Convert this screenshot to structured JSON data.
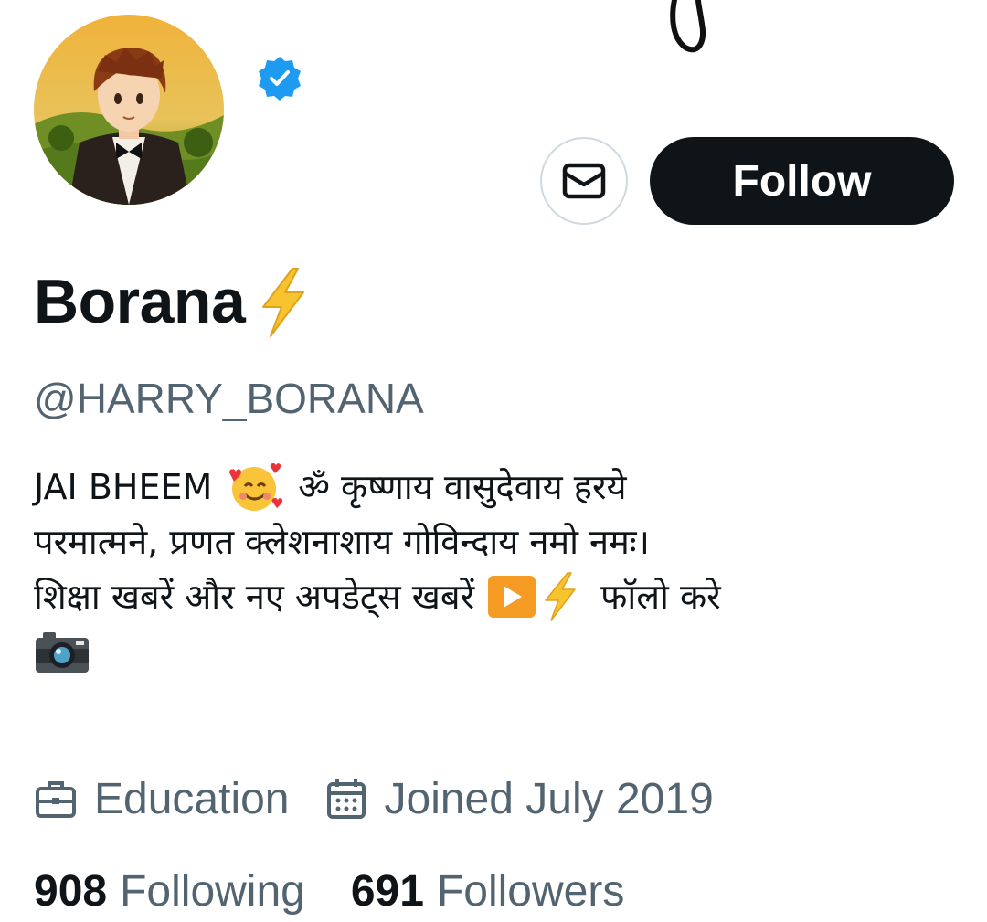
{
  "profile": {
    "display_name": "Borana",
    "name_emoji": "lightning-emoji",
    "handle": "@HARRY_BORANA",
    "verified": true,
    "bio": {
      "line1_text": "JAI BHEEM",
      "line1_after": "ॐ कृष्णाय वासुदेवाय हरये",
      "line2": "परमात्मने, प्रणत क्लेशनाशाय गोविन्दाय नमो नमः।",
      "line3_text": "शिक्षा खबरें और नए अपडेट्स खबरें",
      "line3_after": "फॉलो करे"
    },
    "category": "Education",
    "joined": "Joined July 2019",
    "following_count": "908",
    "following_label": "Following",
    "followers_count": "691",
    "followers_label": "Followers"
  },
  "actions": {
    "follow_label": "Follow",
    "message_icon": "envelope-icon"
  },
  "colors": {
    "primary_text": "#0f1419",
    "secondary_text": "#536471",
    "verified_blue": "#1d9bf0",
    "button_border": "#cfd9de"
  }
}
